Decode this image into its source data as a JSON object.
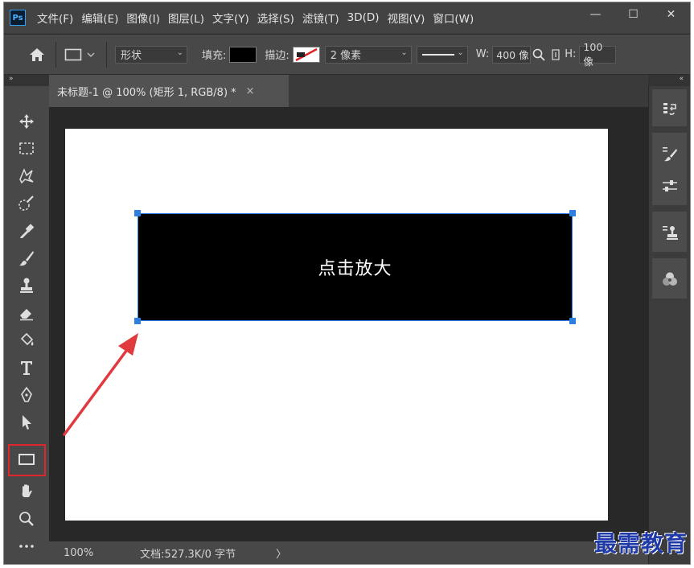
{
  "app": {
    "logo": "Ps"
  },
  "menu": {
    "items": [
      "文件(F)",
      "编辑(E)",
      "图像(I)",
      "图层(L)",
      "文字(Y)",
      "选择(S)",
      "滤镜(T)",
      "3D(D)",
      "视图(V)",
      "窗口(W)"
    ]
  },
  "window_controls": {
    "minimize": "—",
    "restore": "☐",
    "close": "✕"
  },
  "options": {
    "mode": "形状",
    "fill_label": "填充:",
    "fill_color": "#000000",
    "stroke_label": "描边:",
    "stroke_width": "2 像素",
    "w_label": "W:",
    "w_value": "400 像",
    "h_label": "H:",
    "h_value": "100 像"
  },
  "panel_collapse": {
    "left": "»",
    "right": "«"
  },
  "document": {
    "tab_title": "未标题-1 @ 100% (矩形 1, RGB/8) *",
    "tab_close": "×",
    "shape_label": "点击放大"
  },
  "status": {
    "zoom": "100%",
    "doc_info": "文档:527.3K/0 字节",
    "arrow": "〉"
  },
  "toolbar": {
    "active_tool": "rectangle-tool",
    "highlight_color": "#e0262c"
  },
  "annotation": {
    "arrow_color": "#e0393e"
  },
  "accent_color": "#2f7fe0",
  "watermark": "最需教育"
}
